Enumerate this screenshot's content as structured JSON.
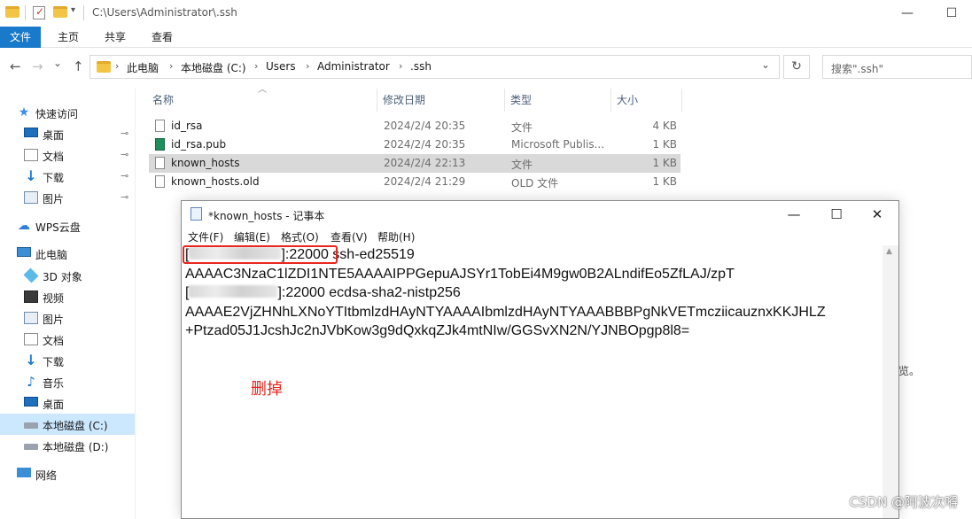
{
  "explorer": {
    "title_path": "C:\\Users\\Administrator\\.ssh",
    "quick_access_dropdown": "▾",
    "window_controls": {
      "minimize": "—",
      "maximize": "☐"
    },
    "ribbon_tabs": [
      {
        "label": "文件",
        "active": true
      },
      {
        "label": "主页",
        "active": false
      },
      {
        "label": "共享",
        "active": false
      },
      {
        "label": "查看",
        "active": false
      }
    ],
    "nav": {
      "back": "←",
      "forward": "→",
      "up": "↑",
      "history": "⌄"
    },
    "breadcrumb": [
      "此电脑",
      "本地磁盘 (C:)",
      "Users",
      "Administrator",
      ".ssh"
    ],
    "refresh": "↻",
    "address_dropdown": "⌄",
    "search_placeholder": "搜索\".ssh\"",
    "columns": [
      "名称",
      "修改日期",
      "类型",
      "大小"
    ],
    "files": [
      {
        "name": "id_rsa",
        "date": "2024/2/4 20:35",
        "type": "文件",
        "size": "4 KB",
        "icon": "file-icon",
        "selected": false
      },
      {
        "name": "id_rsa.pub",
        "date": "2024/2/4 20:35",
        "type": "Microsoft Publis...",
        "size": "1 KB",
        "icon": "publisher-file-icon",
        "selected": false
      },
      {
        "name": "known_hosts",
        "date": "2024/2/4 22:13",
        "type": "文件",
        "size": "1 KB",
        "icon": "file-icon",
        "selected": true
      },
      {
        "name": "known_hosts.old",
        "date": "2024/2/4 21:29",
        "type": "OLD 文件",
        "size": "1 KB",
        "icon": "file-icon",
        "selected": false
      }
    ],
    "partial_text_right": "览。"
  },
  "sidebar": {
    "items": [
      {
        "label": "快速访问",
        "icon": "star-icon",
        "pinned": false
      },
      {
        "label": "桌面",
        "icon": "desktop-icon",
        "pinned": true
      },
      {
        "label": "文档",
        "icon": "documents-icon",
        "pinned": true
      },
      {
        "label": "下载",
        "icon": "download-icon",
        "pinned": true
      },
      {
        "label": "图片",
        "icon": "pictures-icon",
        "pinned": true
      },
      {
        "label": "WPS云盘",
        "icon": "cloud-icon",
        "pinned": false
      },
      {
        "label": "此电脑",
        "icon": "computer-icon",
        "pinned": false
      },
      {
        "label": "3D 对象",
        "icon": "3d-objects-icon",
        "pinned": false
      },
      {
        "label": "视频",
        "icon": "video-icon",
        "pinned": false
      },
      {
        "label": "图片",
        "icon": "pictures-icon",
        "pinned": false
      },
      {
        "label": "文档",
        "icon": "documents-icon",
        "pinned": false
      },
      {
        "label": "下载",
        "icon": "download-icon",
        "pinned": false
      },
      {
        "label": "音乐",
        "icon": "music-icon",
        "pinned": false
      },
      {
        "label": "桌面",
        "icon": "desktop-icon",
        "pinned": false
      },
      {
        "label": "本地磁盘 (C:)",
        "icon": "drive-icon",
        "pinned": false,
        "selected": true
      },
      {
        "label": "本地磁盘 (D:)",
        "icon": "drive-icon",
        "pinned": false
      },
      {
        "label": "网络",
        "icon": "network-icon",
        "pinned": false
      }
    ],
    "pin_glyph": "📌"
  },
  "notepad": {
    "title": "*known_hosts - 记事本",
    "controls": {
      "minimize": "—",
      "maximize": "☐",
      "close": "✕"
    },
    "menu": [
      "文件(F)",
      "编辑(E)",
      "格式(O)",
      "查看(V)",
      "帮助(H)"
    ],
    "lines": {
      "l1_open": "[",
      "l1_port": "]:22000",
      "l1_rest": " ssh-ed25519",
      "l2": "AAAAC3NzaC1lZDI1NTE5AAAAIPPGepuAJSYr1TobEi4M9gw0B2ALndifEo5ZfLAJ/zpT",
      "l3_open": "[",
      "l3_rest": "]:22000 ecdsa-sha2-nistp256",
      "l4": "AAAAE2VjZHNhLXNoYTItbmlzdHAyNTYAAAAIbmlzdHAyNTYAAABBBPgNkVETmcziicauznxKKJHLZ",
      "l5": "+Ptzad05J1JcshJc2nJVbKow3g9dQxkqZJk4mtNIw/GGSvXN2N/YJNBOpgp8l8="
    },
    "annotation": "删掉",
    "annotation_color": "#e8261d"
  },
  "watermark": "CSDN @阿波次嘚"
}
